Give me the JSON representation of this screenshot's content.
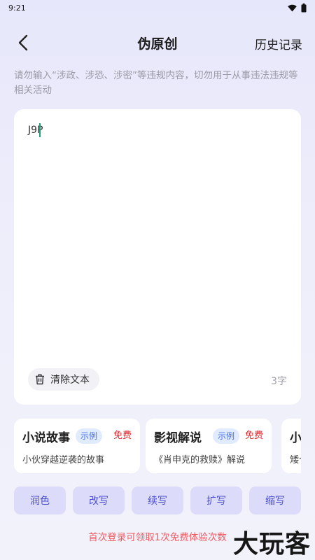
{
  "status_bar": {
    "time": "9:21"
  },
  "header": {
    "title": "伪原创",
    "history_label": "历史记录"
  },
  "notice": "请勿输入“涉政、涉恐、涉密”等违规内容，切勿用于从事违法违规等相关活动",
  "editor": {
    "value": "J9P",
    "clear_label": "清除文本",
    "char_count": "3字"
  },
  "examples": [
    {
      "title": "小说故事",
      "tag": "示例",
      "badge": "免费",
      "desc": "小伙穿越逆袭的故事"
    },
    {
      "title": "影视解说",
      "tag": "示例",
      "badge": "免费",
      "desc": "《肖申克的救赎》解说"
    },
    {
      "title": "小",
      "tag": "",
      "badge": "",
      "desc": "矮个"
    }
  ],
  "tools": [
    "润色",
    "改写",
    "续写",
    "扩写",
    "缩写"
  ],
  "promo": "首次登录可领取1次免费体验次数",
  "watermark": "大玩客",
  "colors": {
    "accent": "#4b4fce",
    "tool_bg": "#dcdcfa",
    "free_red": "#e0262b",
    "tag_blue": "#4670e8",
    "caret": "#1aa37a"
  }
}
